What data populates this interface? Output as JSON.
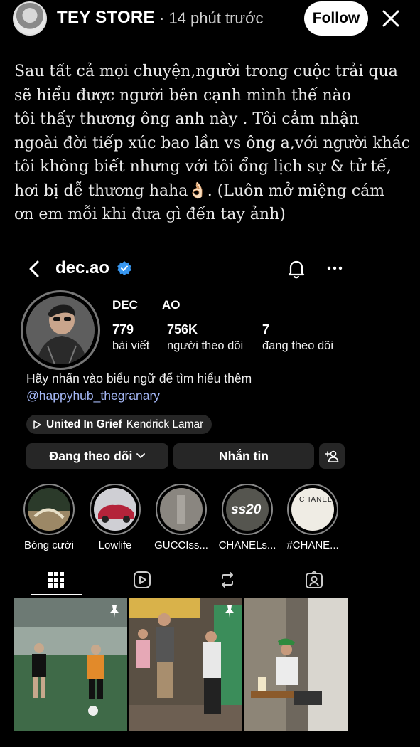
{
  "story": {
    "author": "TEY STORE",
    "time": "· 14 phút trước",
    "follow_label": "Follow",
    "close_icon": "close-icon"
  },
  "caption": "Sau tất cả mọi chuyện,người trong cuộc trải qua\nsẽ hiểu được người bên cạnh mình thế nào\ntôi thấy thương ông anh này . Tôi cảm nhận\nngoài đời tiếp xúc bao lần vs ông a,với người khác\ntôi không biết nhưng với tôi ổng lịch sự & tử tế,\nhơi bị dễ thương haha👌🏻.  (Luôn mở miệng cám\nơn em mỗi khi đưa gì đến tay ảnh)",
  "profile": {
    "username": "dec.ao",
    "full_name": "DEC AO",
    "stats": [
      {
        "value": "779",
        "label": "bài viết"
      },
      {
        "value": "756K",
        "label": "người theo dõi"
      },
      {
        "value": "7",
        "label": "đang theo dõi"
      }
    ],
    "bio": "Hãy nhấn vào biểu ngữ để tìm hiểu thêm",
    "bio_link": "@happyhub_thegranary",
    "music": {
      "song": "United In Grief",
      "artist": "Kendrick Lamar"
    },
    "buttons": {
      "following": "Đang theo dõi",
      "message": "Nhắn tin"
    },
    "highlights": [
      {
        "label": "Bóng cười"
      },
      {
        "label": "Lowlife"
      },
      {
        "label": "GUCCIss..."
      },
      {
        "label": "CHANELs..."
      },
      {
        "label": "#CHANE..."
      }
    ],
    "highlight_badges": {
      "ss20": "ss20",
      "chanel": "CHANEL"
    },
    "tabs": [
      "grid-icon",
      "reels-icon",
      "reposts-icon",
      "tagged-icon"
    ]
  },
  "colors": {
    "background": "#000000",
    "link": "#a4b7f5",
    "button_bg": "#262626",
    "verified": "#3897f0"
  }
}
